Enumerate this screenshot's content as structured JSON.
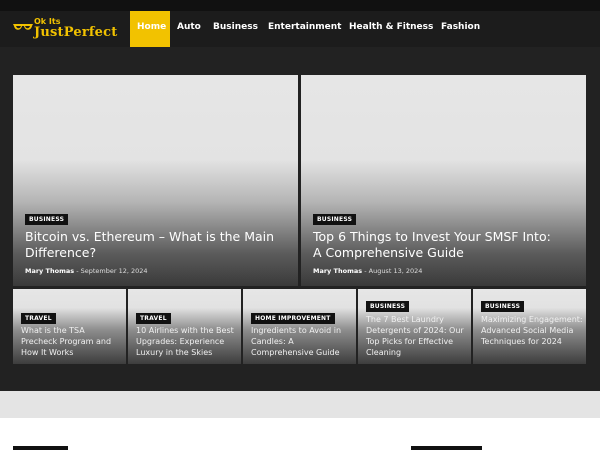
{
  "logo": {
    "top": "Ok Its",
    "brand": "JustPerfect",
    "icon": "sunglasses-icon"
  },
  "nav": {
    "items": [
      "Home",
      "Auto",
      "Business",
      "Entertainment",
      "Health & Fitness",
      "Fashion"
    ],
    "active": "Home"
  },
  "colors": {
    "accent": "#f2c200",
    "nav_bg": "#1c1c1c",
    "main_bg": "#222222"
  },
  "featured": [
    {
      "category": "BUSINESS",
      "title": "Bitcoin vs. Ethereum – What is the Main Difference?",
      "author": "Mary Thomas",
      "date": "September 12, 2024"
    },
    {
      "category": "BUSINESS",
      "title": "Top 6 Things to Invest Your SMSF Into: A Comprehensive Guide",
      "author": "Mary Thomas",
      "date": "August 13, 2024"
    }
  ],
  "cards": [
    {
      "category": "TRAVEL",
      "title": "What is the TSA Precheck Program and How It Works"
    },
    {
      "category": "TRAVEL",
      "title": "10 Airlines with the Best Upgrades: Experience Luxury in the Skies"
    },
    {
      "category": "HOME IMPROVEMENT",
      "title": "Ingredients to Avoid in Candles: A Comprehensive Guide"
    },
    {
      "category": "BUSINESS",
      "title": "The 7 Best Laundry Detergents of 2024: Our Top Picks for Effective Cleaning"
    },
    {
      "category": "BUSINESS",
      "title": "Maximizing Engagement: Advanced Social Media Techniques for 2024"
    }
  ]
}
